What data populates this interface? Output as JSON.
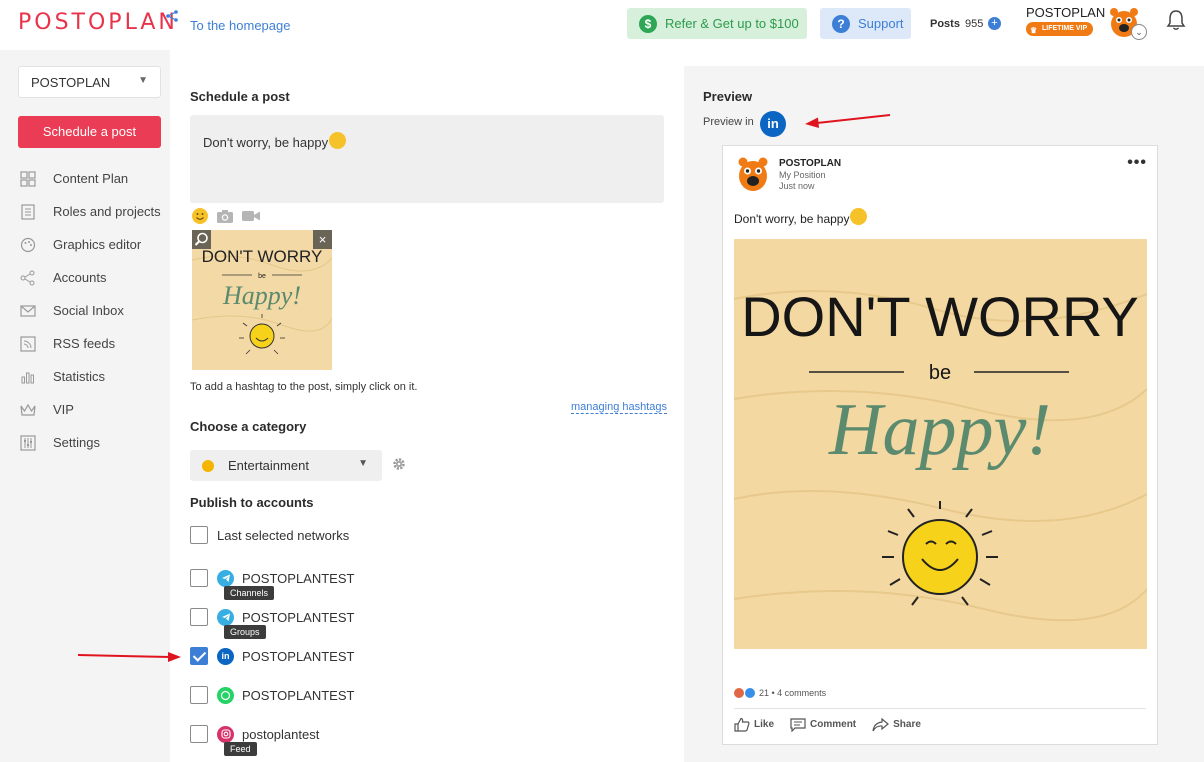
{
  "header": {
    "logo": "POSTOPLAN",
    "home_link": "To the homepage",
    "refer_label": "Refer & Get up to $100",
    "support_label": "Support",
    "posts_label": "Posts",
    "posts_count": "955",
    "user_name": "POSTOPLAN",
    "vip_label": "LIFETIME VIP"
  },
  "sidebar": {
    "project": "POSTOPLAN",
    "schedule_button": "Schedule a post",
    "items": [
      {
        "label": "Content Plan",
        "icon": "grid-icon"
      },
      {
        "label": "Roles and projects",
        "icon": "list-icon"
      },
      {
        "label": "Graphics editor",
        "icon": "palette-icon"
      },
      {
        "label": "Accounts",
        "icon": "share-icon"
      },
      {
        "label": "Social Inbox",
        "icon": "mail-icon"
      },
      {
        "label": "RSS feeds",
        "icon": "rss-icon"
      },
      {
        "label": "Statistics",
        "icon": "chart-icon"
      },
      {
        "label": "VIP",
        "icon": "crown-icon"
      },
      {
        "label": "Settings",
        "icon": "sliders-icon"
      }
    ]
  },
  "form": {
    "title": "Schedule a post",
    "post_text": "Don't worry, be happy",
    "hashtag_hint": "To add a hashtag to the post, simply click on it.",
    "managing_hashtags": "managing hashtags",
    "category_title": "Choose a category",
    "category_value": "Entertainment",
    "accounts_title": "Publish to accounts",
    "last_selected": "Last selected networks",
    "accounts": [
      {
        "name": "POSTOPLANTEST",
        "network": "telegram",
        "tag": "Channels",
        "checked": false
      },
      {
        "name": "POSTOPLANTEST",
        "network": "telegram",
        "tag": "Groups",
        "checked": false
      },
      {
        "name": "POSTOPLANTEST",
        "network": "linkedin",
        "tag": "",
        "checked": true
      },
      {
        "name": "POSTOPLANTEST",
        "network": "whatsapp",
        "tag": "",
        "checked": false
      },
      {
        "name": "postoplantest",
        "network": "instagram",
        "tag": "Feed",
        "checked": false
      }
    ]
  },
  "image_text": {
    "line1": "DON'T WORRY",
    "line2": "be",
    "line3": "Happy!"
  },
  "preview": {
    "title": "Preview",
    "preview_in": "Preview in",
    "network_badge": "in",
    "card": {
      "name": "POSTOPLAN",
      "position": "My Position",
      "time": "Just now",
      "text": "Don't worry, be happy",
      "stats": "21 • 4 comments",
      "like": "Like",
      "comment": "Comment",
      "share": "Share"
    }
  },
  "colors": {
    "brand": "#e8334a",
    "linkedin": "#0a66c2",
    "telegram": "#37aee2",
    "whatsapp": "#25d366",
    "instagram": "#d6336c"
  }
}
